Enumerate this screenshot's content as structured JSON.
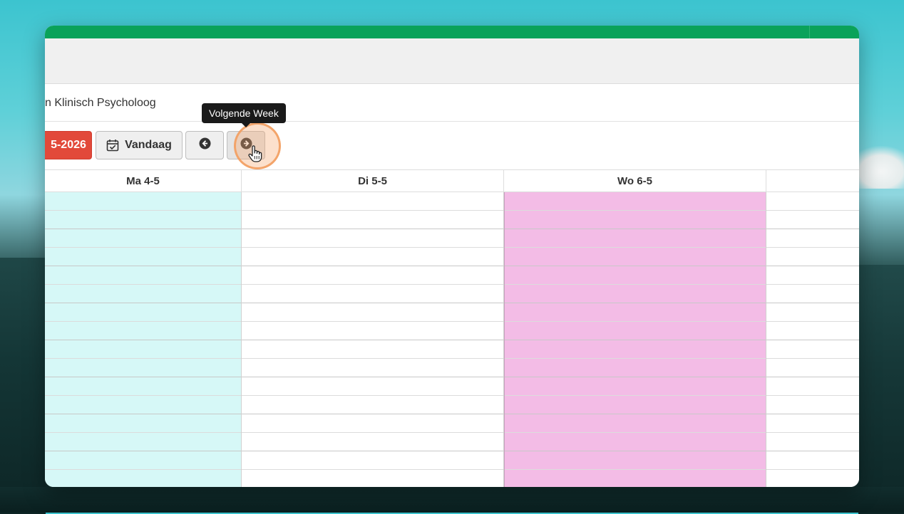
{
  "header": {
    "title": "n Klinisch Psycholoog"
  },
  "toolbar": {
    "date_label": "5-2026",
    "today_label": "Vandaag",
    "tooltip": "Volgende Week",
    "icons": {
      "today": "calendar-check-icon",
      "prev": "arrow-left-circle-icon",
      "next": "arrow-right-circle-icon",
      "cursor": "hand-pointer-icon"
    }
  },
  "calendar": {
    "days": [
      {
        "label": "Ma 4-5",
        "color": "#d6f8f7"
      },
      {
        "label": "Di 5-5",
        "color": "#ffffff"
      },
      {
        "label": "Wo 6-5",
        "color": "#f3bce6"
      },
      {
        "label": "",
        "color": "#ffffff"
      }
    ]
  },
  "colors": {
    "topbar": "#0aa25a",
    "date_button": "#e2493a",
    "tooltip": "#1a1a1a"
  }
}
